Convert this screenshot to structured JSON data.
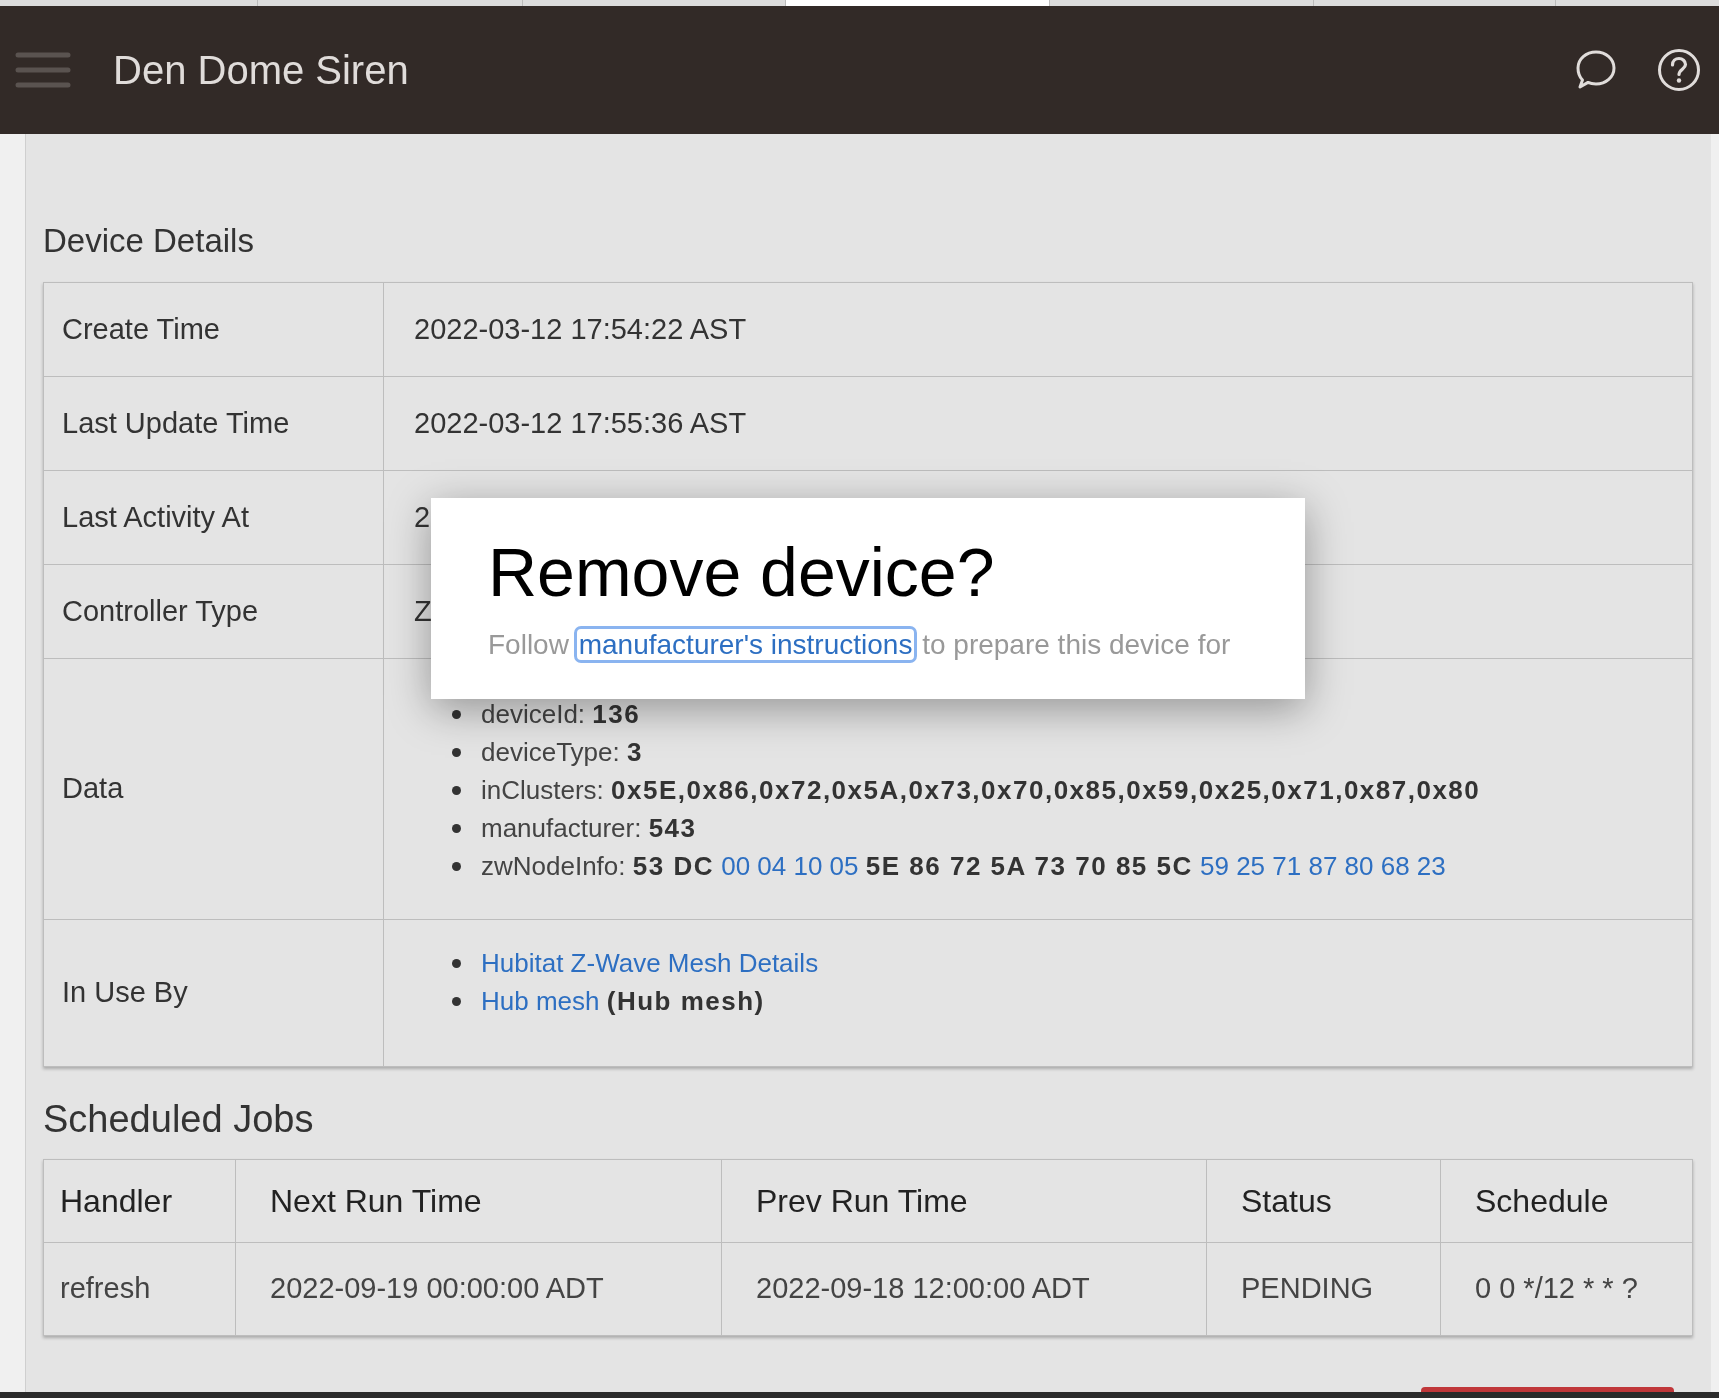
{
  "header": {
    "title": "Den Dome Siren"
  },
  "device_details": {
    "title": "Device Details",
    "rows": [
      {
        "kind": "text",
        "label": "Create Time",
        "value": "2022-03-12 17:54:22 AST"
      },
      {
        "kind": "text",
        "label": "Last Update Time",
        "value": "2022-03-12 17:55:36 AST"
      },
      {
        "kind": "text",
        "label": "Last Activity At",
        "value": "2"
      },
      {
        "kind": "text",
        "label": "Controller Type",
        "value": "Z"
      },
      {
        "kind": "list",
        "label": "Data",
        "items": [
          {
            "key": "deviceId:",
            "parts": [
              {
                "kind": "bold",
                "text": "136"
              }
            ]
          },
          {
            "key": "deviceType:",
            "parts": [
              {
                "kind": "bold",
                "text": "3"
              }
            ]
          },
          {
            "key": "inClusters:",
            "parts": [
              {
                "kind": "bold",
                "text": "0x5E,0x86,0x72,0x5A,0x73,0x70,0x85,0x59,0x25,0x71,0x87,0x80"
              }
            ]
          },
          {
            "key": "manufacturer:",
            "parts": [
              {
                "kind": "bold",
                "text": "543"
              }
            ]
          },
          {
            "key": "zwNodeInfo:",
            "parts": [
              {
                "kind": "bold",
                "text": "53 DC"
              },
              {
                "kind": "link",
                "text": "00 04 10 05"
              },
              {
                "kind": "bold",
                "text": "5E 86 72 5A 73 70 85 5C"
              },
              {
                "kind": "link",
                "text": "59 25 71 87 80 68 23"
              }
            ]
          }
        ]
      },
      {
        "kind": "list",
        "label": "In Use By",
        "items": [
          {
            "parts": [
              {
                "kind": "link",
                "text": "Hubitat Z-Wave Mesh Details"
              }
            ]
          },
          {
            "parts": [
              {
                "kind": "link",
                "text": "Hub mesh"
              },
              {
                "kind": "bold",
                "text": "(Hub mesh)"
              }
            ]
          }
        ]
      }
    ]
  },
  "scheduled_jobs": {
    "title": "Scheduled Jobs",
    "columns": [
      "Handler",
      "Next Run Time",
      "Prev Run Time",
      "Status",
      "Schedule"
    ],
    "rows": [
      [
        "refresh",
        "2022-09-19 00:00:00 ADT",
        "2022-09-18 12:00:00 ADT",
        "PENDING",
        "0 0 */12 * * ?"
      ]
    ]
  },
  "dialog": {
    "title": "Remove device?",
    "text_before": "Follow",
    "link": "manufacturer's instructions",
    "text_after": "to prepare this device for"
  }
}
